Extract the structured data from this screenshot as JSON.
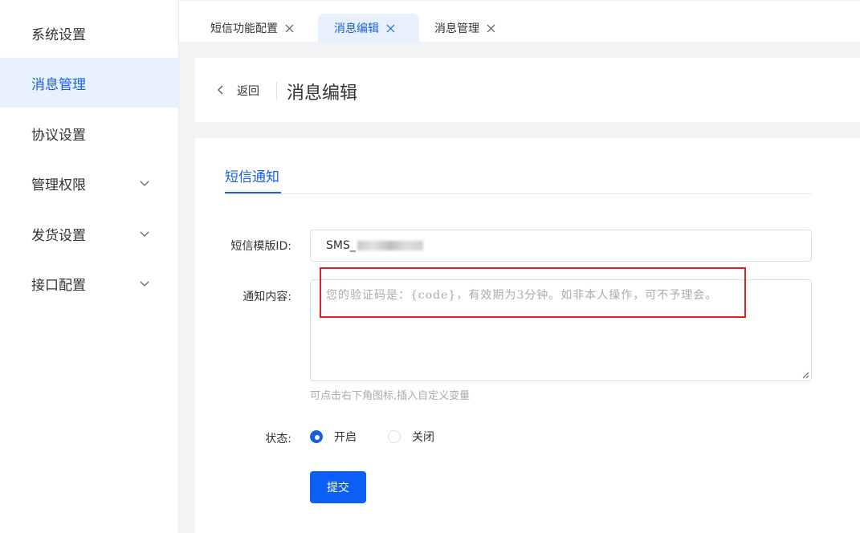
{
  "sidebar": {
    "items": [
      {
        "label": "系统设置",
        "has_chevron": false,
        "active": false
      },
      {
        "label": "消息管理",
        "has_chevron": false,
        "active": true
      },
      {
        "label": "协议设置",
        "has_chevron": false,
        "active": false
      },
      {
        "label": "管理权限",
        "has_chevron": true,
        "active": false
      },
      {
        "label": "发货设置",
        "has_chevron": true,
        "active": false
      },
      {
        "label": "接口配置",
        "has_chevron": true,
        "active": false
      }
    ]
  },
  "tabs": [
    {
      "label": "短信功能配置",
      "active": false
    },
    {
      "label": "消息编辑",
      "active": true
    },
    {
      "label": "消息管理",
      "active": false
    }
  ],
  "header": {
    "back_label": "返回",
    "title": "消息编辑"
  },
  "section": {
    "tab_label": "短信通知"
  },
  "form": {
    "template_id_label": "短信模版ID:",
    "template_id_value": "SMS_",
    "content_label": "通知内容:",
    "content_value": "您的验证码是：{code}，有效期为3分钟。如非本人操作，可不予理会。",
    "hint": "可点击右下角图标,插入自定义变量",
    "status_label": "状态:",
    "status_options": [
      {
        "label": "开启",
        "checked": true
      },
      {
        "label": "关闭",
        "checked": false
      }
    ],
    "submit_label": "提交"
  },
  "colors": {
    "accent": "#1a5fe0",
    "button": "#0d5ef5",
    "highlight_border": "#d9252a",
    "active_bg": "#e8f0fe"
  },
  "icons": {
    "tab_close": "close-icon",
    "back": "chevron-left-icon",
    "expand": "chevron-down-icon",
    "resize": "resize-grip-icon"
  }
}
